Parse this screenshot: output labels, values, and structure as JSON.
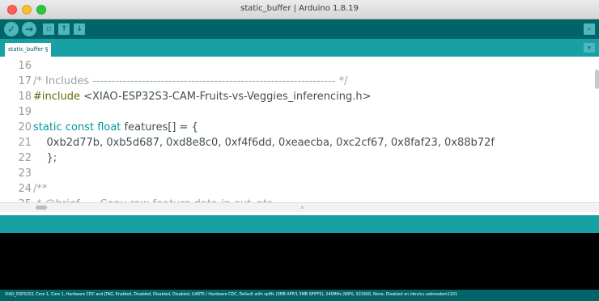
{
  "window": {
    "title": "static_buffer | Arduino 1.8.19"
  },
  "toolbar": {
    "verify_icon": "check-icon",
    "upload_icon": "arrow-right-icon",
    "new_icon": "new-file-icon",
    "open_icon": "arrow-up-icon",
    "save_icon": "arrow-down-icon",
    "serial_icon": "magnifier-icon"
  },
  "tabs": {
    "active": "static_buffer §",
    "menu_icon": "chevron-down-icon"
  },
  "editor": {
    "lines": [
      {
        "num": "16",
        "segments": []
      },
      {
        "num": "17",
        "segments": [
          {
            "cls": "cm",
            "text": "/* Includes ---------------------------------------------------------------- */"
          }
        ]
      },
      {
        "num": "18",
        "segments": [
          {
            "cls": "kw-pre",
            "text": "#include"
          },
          {
            "cls": "",
            "text": " <XIAO-ESP32S3-CAM-Fruits-vs-Veggies_inferencing.h>"
          }
        ]
      },
      {
        "num": "19",
        "segments": []
      },
      {
        "num": "20",
        "segments": [
          {
            "cls": "kw",
            "text": "static"
          },
          {
            "cls": "",
            "text": " "
          },
          {
            "cls": "kw",
            "text": "const"
          },
          {
            "cls": "",
            "text": " "
          },
          {
            "cls": "kw",
            "text": "float"
          },
          {
            "cls": "",
            "text": " features[] = {"
          }
        ]
      },
      {
        "num": "21",
        "segments": [
          {
            "cls": "",
            "text": "    0xb2d77b, 0xb5d687, 0xd8e8c0, 0xf4f6dd, 0xeaecba, 0xc2cf67, 0x8faf23, 0x88b72f"
          }
        ]
      },
      {
        "num": "22",
        "segments": [
          {
            "cls": "",
            "text": "    };"
          }
        ]
      },
      {
        "num": "23",
        "segments": []
      },
      {
        "num": "24",
        "segments": [
          {
            "cls": "cm",
            "text": "/**"
          }
        ]
      },
      {
        "num": "25",
        "segments": [
          {
            "cls": "cm",
            "text": " * @brief      Copy raw feature data in out_ptr"
          }
        ]
      }
    ]
  },
  "status": {
    "text": "XIAO_ESP32S3, Core 1, Core 1, Hardware CDC and JTAG, Enabled, Disabled, Disabled, Disabled, UART0 / Hardware CDC, Default with spiffs (3MB APP/1.5MB SPIFFS), 240MHz (WiFi), 921600, None, Disabled on /dev/cu.usbmodem1101"
  }
}
